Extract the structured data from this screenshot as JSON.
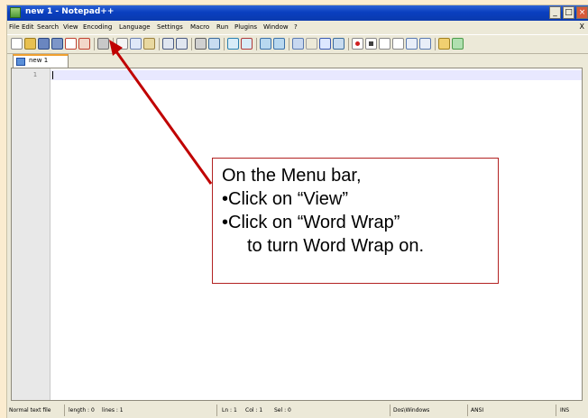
{
  "window": {
    "title": "new 1 - Notepad++",
    "controls": {
      "minimize": "_",
      "maximize": "□",
      "close": "×"
    }
  },
  "menubar": {
    "items": [
      "File",
      "Edit",
      "Search",
      "View",
      "Encoding",
      "Language",
      "Settings",
      "Macro",
      "Run",
      "Plugins",
      "Window",
      "?"
    ],
    "close_label": "X"
  },
  "toolbar": {
    "buttons": [
      "new-file-icon",
      "open-file-icon",
      "save-icon",
      "save-all-icon",
      "close-file-icon",
      "close-all-icon",
      "print-icon",
      "cut-icon",
      "copy-icon",
      "paste-icon",
      "undo-icon",
      "redo-icon",
      "find-icon",
      "replace-icon",
      "zoom-in-icon",
      "zoom-out-icon",
      "sync-v-icon",
      "sync-h-icon",
      "word-wrap-icon",
      "show-all-chars-icon",
      "indent-guide-icon",
      "fold-icon",
      "record-macro-icon",
      "stop-record-icon",
      "play-macro-icon",
      "play-multiple-icon",
      "save-macro-icon",
      "doc-map-icon",
      "spellcheck-icon"
    ]
  },
  "tabs": [
    {
      "label": "new 1"
    }
  ],
  "editor": {
    "line_numbers": [
      "1"
    ]
  },
  "statusbar": {
    "file_type": "Normal text file",
    "length": "length : 0",
    "lines": "lines : 1",
    "ln": "Ln : 1",
    "col": "Col : 1",
    "sel": "Sel : 0",
    "eol": "Dos\\Windows",
    "encoding": "ANSI",
    "mode": "INS"
  },
  "callout": {
    "line1": "On the Menu bar,",
    "line2": "•Click on “View”",
    "line3": "•Click on “Word Wrap”",
    "line4": "to turn Word Wrap on."
  },
  "colors": {
    "titlebar": "#0a3fbf",
    "background": "#fbecd0",
    "arrow": "#c00000",
    "callout_border": "#b22222"
  }
}
